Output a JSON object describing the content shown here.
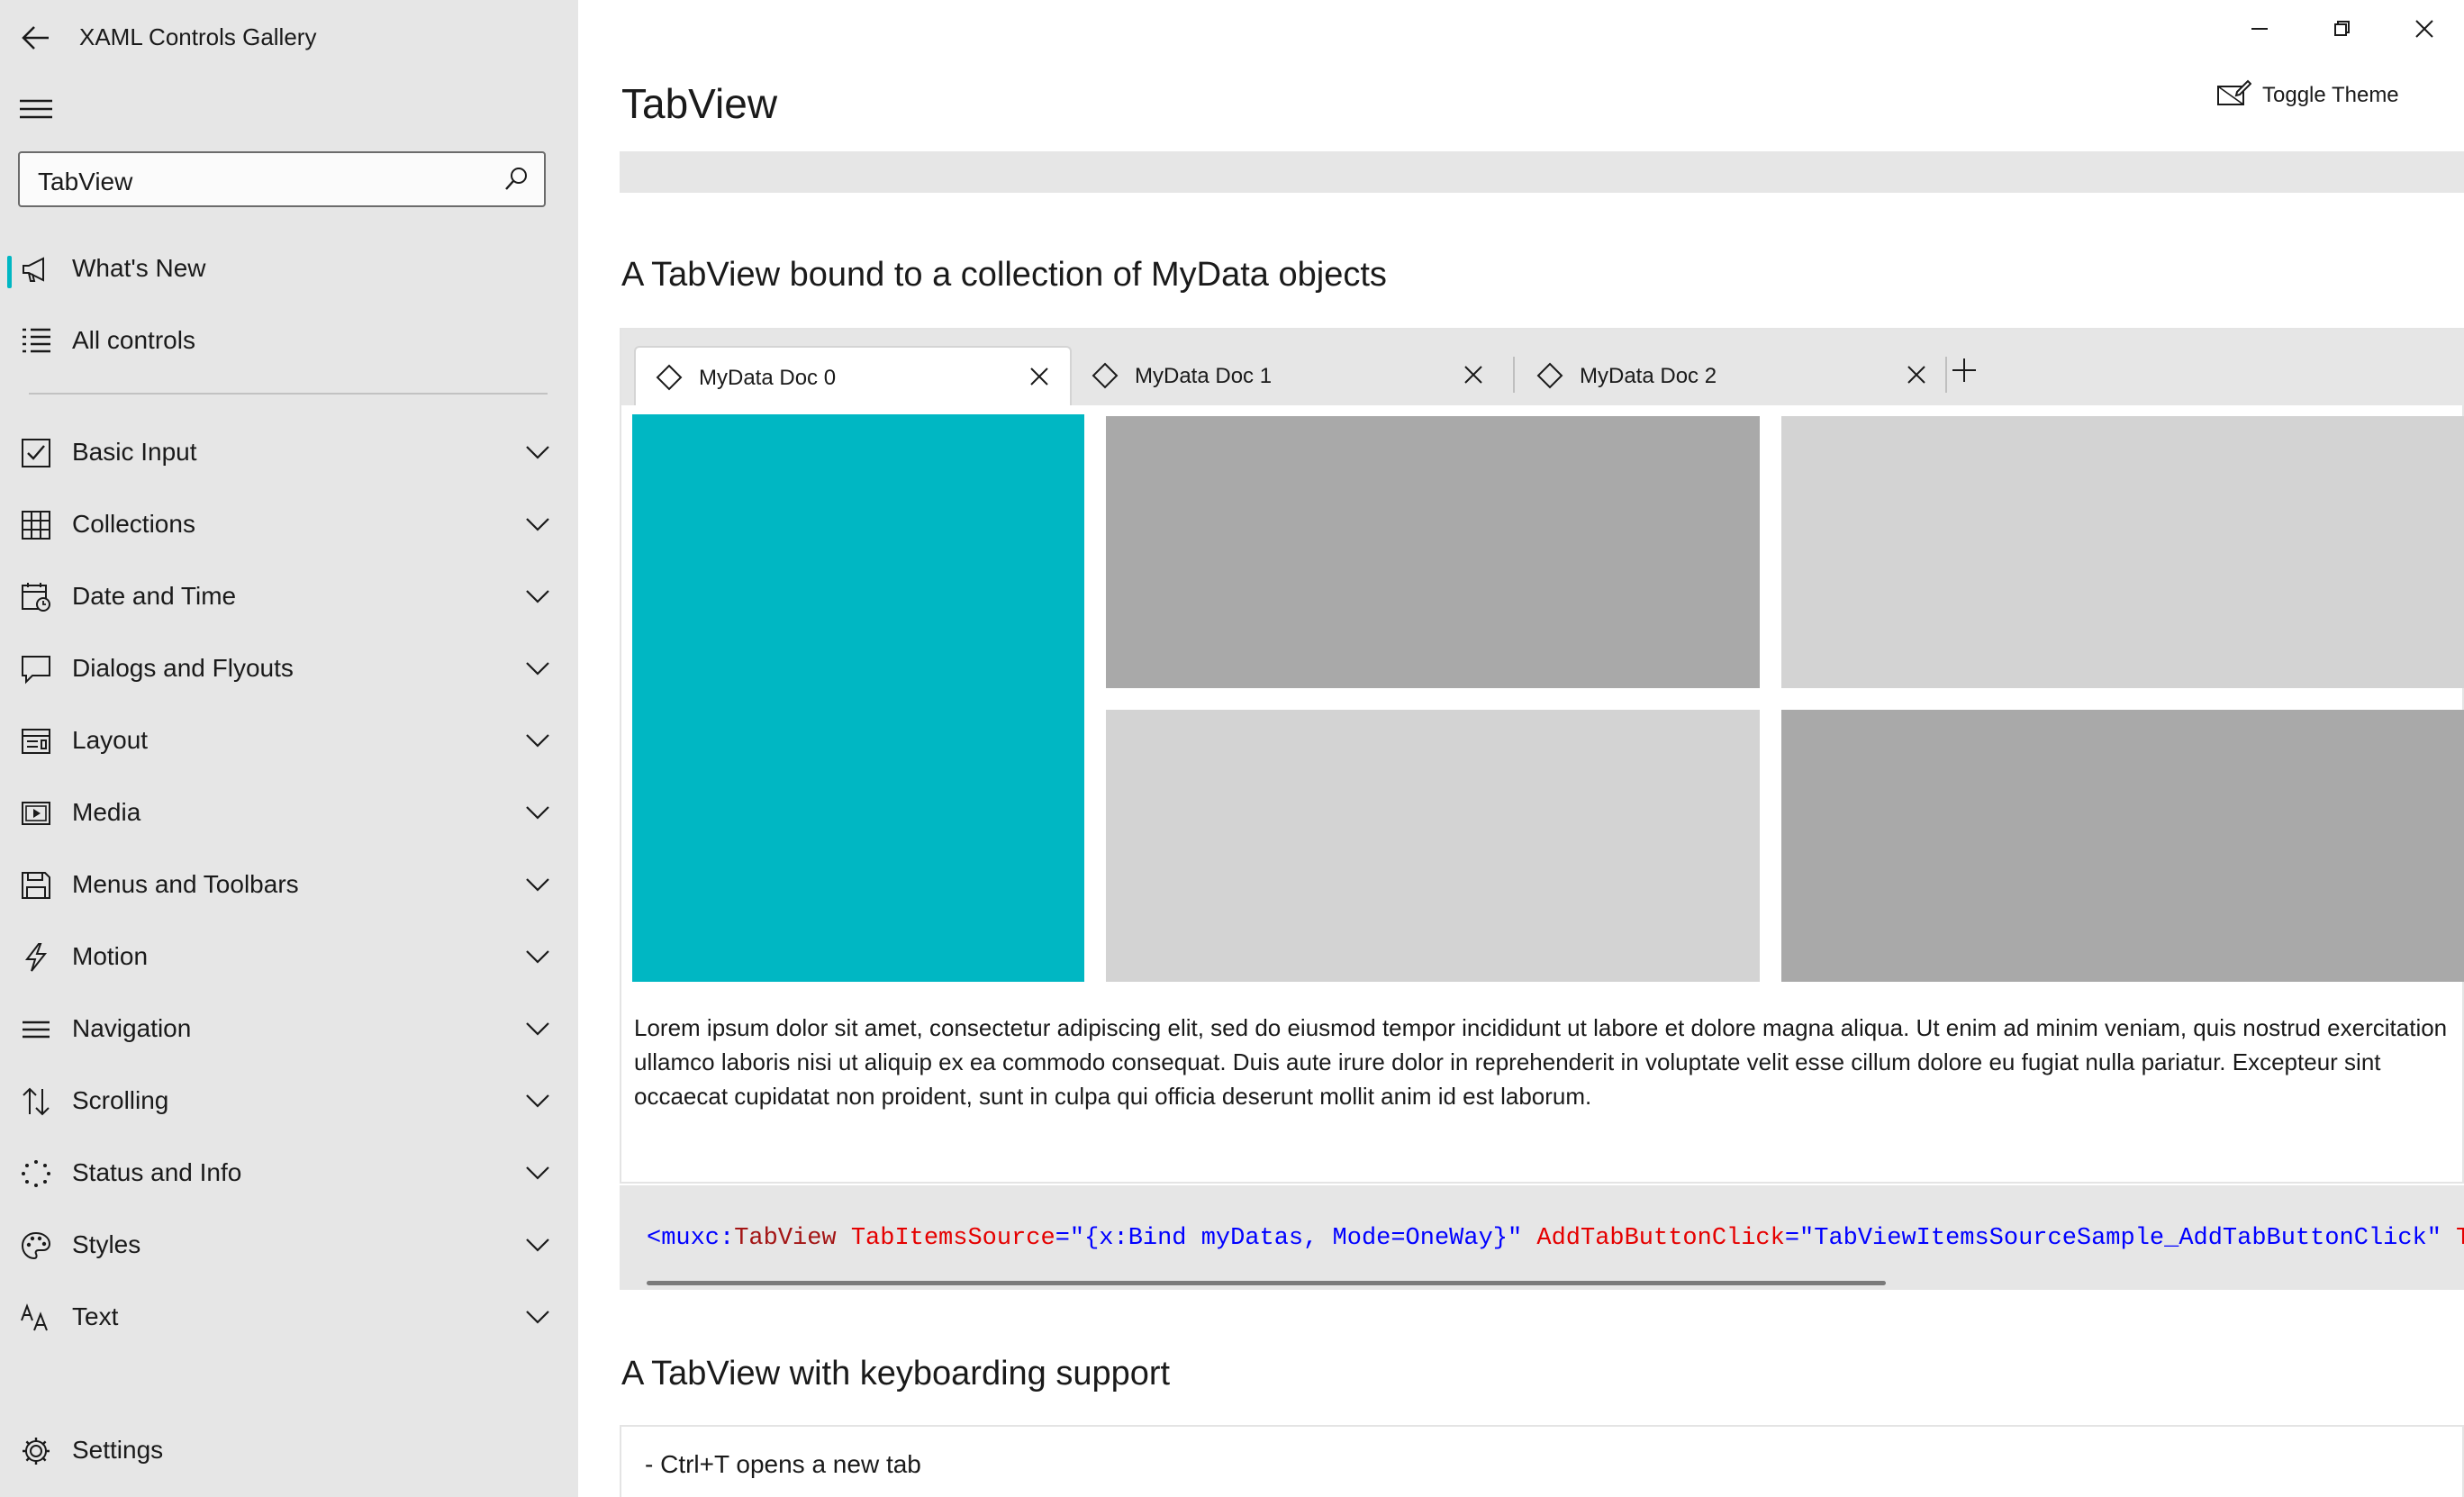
{
  "app": {
    "title": "XAML Controls Gallery"
  },
  "search": {
    "value": "TabView"
  },
  "sidebar": {
    "top_items": [
      {
        "label": "What's New",
        "icon": "megaphone-icon",
        "selected": true
      },
      {
        "label": "All controls",
        "icon": "list-icon"
      }
    ],
    "categories": [
      {
        "label": "Basic Input",
        "icon": "checkbox-icon"
      },
      {
        "label": "Collections",
        "icon": "grid-icon"
      },
      {
        "label": "Date and Time",
        "icon": "calendar-clock-icon"
      },
      {
        "label": "Dialogs and Flyouts",
        "icon": "speech-bubble-icon"
      },
      {
        "label": "Layout",
        "icon": "layout-icon"
      },
      {
        "label": "Media",
        "icon": "media-icon"
      },
      {
        "label": "Menus and Toolbars",
        "icon": "save-disk-icon"
      },
      {
        "label": "Motion",
        "icon": "lightning-icon"
      },
      {
        "label": "Navigation",
        "icon": "navigation-lines-icon"
      },
      {
        "label": "Scrolling",
        "icon": "scroll-arrows-icon"
      },
      {
        "label": "Status and Info",
        "icon": "spinner-dots-icon"
      },
      {
        "label": "Styles",
        "icon": "palette-icon"
      },
      {
        "label": "Text",
        "icon": "font-size-icon"
      }
    ],
    "settings": {
      "label": "Settings",
      "icon": "gear-icon"
    }
  },
  "page": {
    "title": "TabView",
    "toggle_theme": "Toggle Theme"
  },
  "section1": {
    "title": "A TabView bound to a collection of MyData objects",
    "tabs": [
      {
        "label": "MyData Doc 0",
        "active": true
      },
      {
        "label": "MyData Doc 1",
        "active": false
      },
      {
        "label": "MyData Doc 2",
        "active": false
      }
    ],
    "lorem": "Lorem ipsum dolor sit amet, consectetur adipiscing elit, sed do eiusmod tempor incididunt ut labore et dolore magna aliqua. Ut enim ad minim veniam, quis nostrud exercitation ullamco laboris nisi ut aliquip ex ea commodo consequat. Duis aute irure dolor in reprehenderit in voluptate velit esse cillum dolore eu fugiat nulla pariatur. Excepteur sint occaecat cupidatat non proident, sunt in culpa qui officia deserunt mollit anim id est laborum.",
    "code": {
      "p1": "<muxc",
      "p2": ":",
      "p3": "TabView",
      "p4": " TabItemsSource",
      "p5": "=\"",
      "p6": "{x:Bind myDatas, Mode=OneWay}",
      "p7": "\"",
      "p8": " AddTabButtonClick",
      "p9": "=\"",
      "p10": "TabViewItemsSourceSample_AddTabButtonClick",
      "p11": "\"",
      "p12": " TabCl"
    }
  },
  "section2": {
    "title": "A TabView with keyboarding support",
    "lines": [
      "- Ctrl+T opens a new tab"
    ]
  },
  "colors": {
    "accent": "#00b7c3",
    "sidebar_bg": "#e6e6e6",
    "tile_dark": "#a9a9a9",
    "tile_light": "#d3d3d3",
    "code_element": "#a31515",
    "code_attr": "#e50000",
    "code_value": "#0000ff"
  }
}
